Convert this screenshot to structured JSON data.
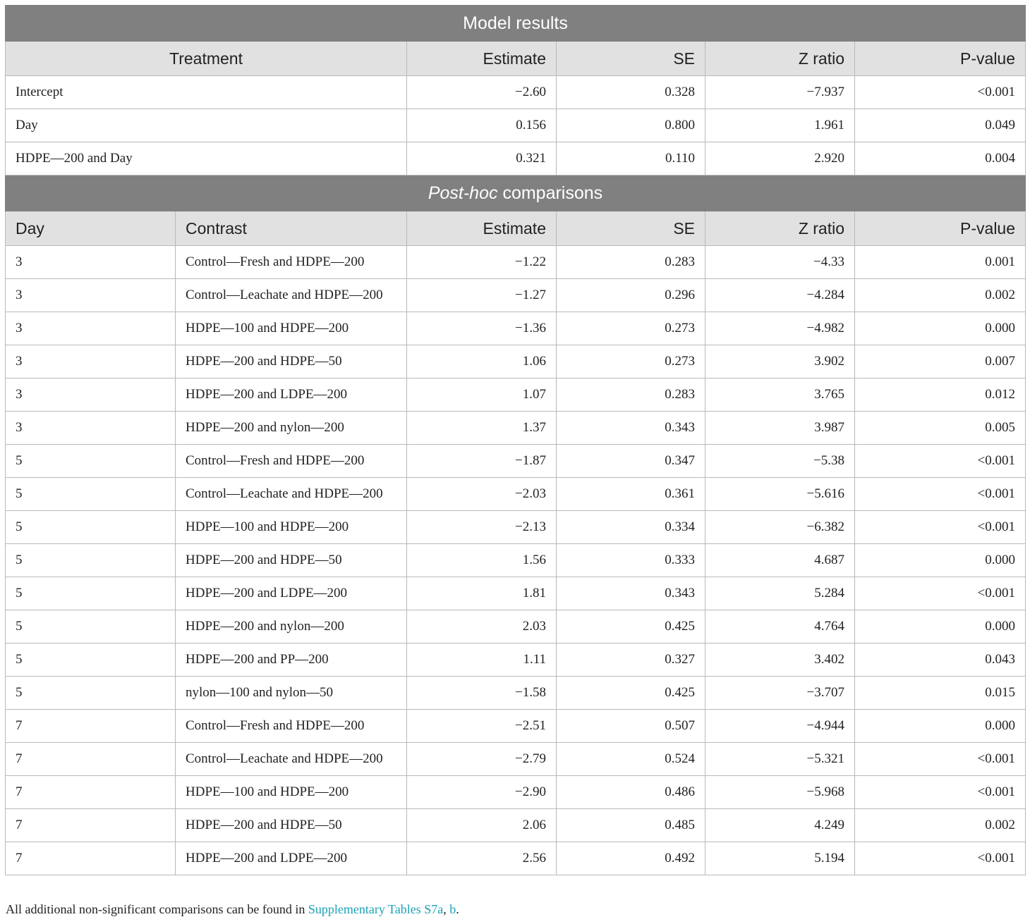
{
  "model_results": {
    "title": "Model results",
    "headers": [
      "Treatment",
      "Estimate",
      "SE",
      "Z ratio",
      "P-value"
    ],
    "rows": [
      [
        "Intercept",
        "−2.60",
        "0.328",
        "−7.937",
        "<0.001"
      ],
      [
        "Day",
        "0.156",
        "0.800",
        "1.961",
        "0.049"
      ],
      [
        "HDPE—200 and Day",
        "0.321",
        "0.110",
        "2.920",
        "0.004"
      ]
    ]
  },
  "posthoc": {
    "title_italic": "Post-hoc",
    "title_rest": " comparisons",
    "headers": [
      "Day",
      "Contrast",
      "Estimate",
      "SE",
      "Z ratio",
      "P-value"
    ],
    "rows": [
      [
        "3",
        "Control—Fresh and HDPE—200",
        "−1.22",
        "0.283",
        "−4.33",
        "0.001"
      ],
      [
        "3",
        "Control—Leachate and HDPE—200",
        "−1.27",
        "0.296",
        "−4.284",
        "0.002"
      ],
      [
        "3",
        "HDPE—100 and HDPE—200",
        "−1.36",
        "0.273",
        "−4.982",
        "0.000"
      ],
      [
        "3",
        "HDPE—200 and HDPE—50",
        "1.06",
        "0.273",
        "3.902",
        "0.007"
      ],
      [
        "3",
        "HDPE—200 and LDPE—200",
        "1.07",
        "0.283",
        "3.765",
        "0.012"
      ],
      [
        "3",
        "HDPE—200 and nylon—200",
        "1.37",
        "0.343",
        "3.987",
        "0.005"
      ],
      [
        "5",
        "Control—Fresh and HDPE—200",
        "−1.87",
        "0.347",
        "−5.38",
        "<0.001"
      ],
      [
        "5",
        "Control—Leachate and HDPE—200",
        "−2.03",
        "0.361",
        "−5.616",
        "<0.001"
      ],
      [
        "5",
        "HDPE—100 and HDPE—200",
        "−2.13",
        "0.334",
        "−6.382",
        "<0.001"
      ],
      [
        "5",
        "HDPE—200 and HDPE—50",
        "1.56",
        "0.333",
        "4.687",
        "0.000"
      ],
      [
        "5",
        "HDPE—200 and LDPE—200",
        "1.81",
        "0.343",
        "5.284",
        "<0.001"
      ],
      [
        "5",
        "HDPE—200 and nylon—200",
        "2.03",
        "0.425",
        "4.764",
        "0.000"
      ],
      [
        "5",
        "HDPE—200 and PP—200",
        "1.11",
        "0.327",
        "3.402",
        "0.043"
      ],
      [
        "5",
        "nylon—100 and nylon—50",
        "−1.58",
        "0.425",
        "−3.707",
        "0.015"
      ],
      [
        "7",
        "Control—Fresh and HDPE—200",
        "−2.51",
        "0.507",
        "−4.944",
        "0.000"
      ],
      [
        "7",
        "Control—Leachate and HDPE—200",
        "−2.79",
        "0.524",
        "−5.321",
        "<0.001"
      ],
      [
        "7",
        "HDPE—100 and HDPE—200",
        "−2.90",
        "0.486",
        "−5.968",
        "<0.001"
      ],
      [
        "7",
        "HDPE—200 and HDPE—50",
        "2.06",
        "0.485",
        "4.249",
        "0.002"
      ],
      [
        "7",
        "HDPE—200 and LDPE—200",
        "2.56",
        "0.492",
        "5.194",
        "<0.001"
      ]
    ]
  },
  "footnote": {
    "text": "All additional non-significant comparisons can be found in ",
    "link1": "Supplementary Tables S7a",
    "sep": ", ",
    "link2": "b",
    "end": "."
  }
}
